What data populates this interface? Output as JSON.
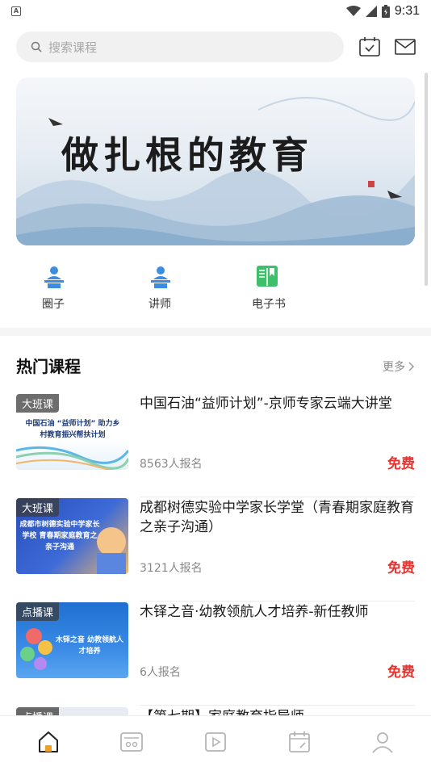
{
  "status_bar": {
    "notification_label": "A",
    "time": "9:31",
    "icons": [
      "wifi-icon",
      "signal-icon",
      "battery-icon"
    ]
  },
  "search": {
    "placeholder": "搜索课程"
  },
  "header_icons": [
    "calendar-check-icon",
    "mail-icon"
  ],
  "banner": {
    "title": "做扎根的教育"
  },
  "quick_nav": [
    {
      "label": "圈子",
      "icon": "user-podium-icon"
    },
    {
      "label": "讲师",
      "icon": "teacher-podium-icon"
    },
    {
      "label": "电子书",
      "icon": "ebook-icon"
    }
  ],
  "hot_section": {
    "title": "热门课程",
    "more": "更多"
  },
  "courses": [
    {
      "tag": "大班课",
      "thumb_text": "中国石油 “益师计划” 助力乡村教育振兴帮扶计划",
      "title": "中国石油“益师计划”-京师专家云端大讲堂",
      "enrolled": "8563人报名",
      "price": "免费"
    },
    {
      "tag": "大班课",
      "thumb_text": "成都市树德实验中学家长学校 青春期家庭教育之亲子沟通",
      "title": "成都树德实验中学家长学堂（青春期家庭教育之亲子沟通）",
      "enrolled": "3121人报名",
      "price": "免费"
    },
    {
      "tag": "点播课",
      "thumb_text": "木铎之音 幼教领航人才培养",
      "title": "木铎之音·幼教领航人才培养-新任教师",
      "enrolled": "6人报名",
      "price": "免费"
    },
    {
      "tag": "点播课",
      "thumb_text": "",
      "title": "【第七期】家庭教育指导师",
      "enrolled": "",
      "price": ""
    }
  ],
  "tab_bar": {
    "tabs": [
      {
        "icon": "home-icon",
        "active": true
      },
      {
        "icon": "classroom-icon",
        "active": false
      },
      {
        "icon": "video-icon",
        "active": false
      },
      {
        "icon": "schedule-icon",
        "active": false
      },
      {
        "icon": "profile-icon",
        "active": false
      }
    ],
    "active_color": "#f0a020",
    "inactive_color": "#b5b5b5"
  },
  "colors": {
    "price": "#e8332f",
    "nav_blue": "#3b8de0",
    "nav_green": "#3fbf6a"
  }
}
